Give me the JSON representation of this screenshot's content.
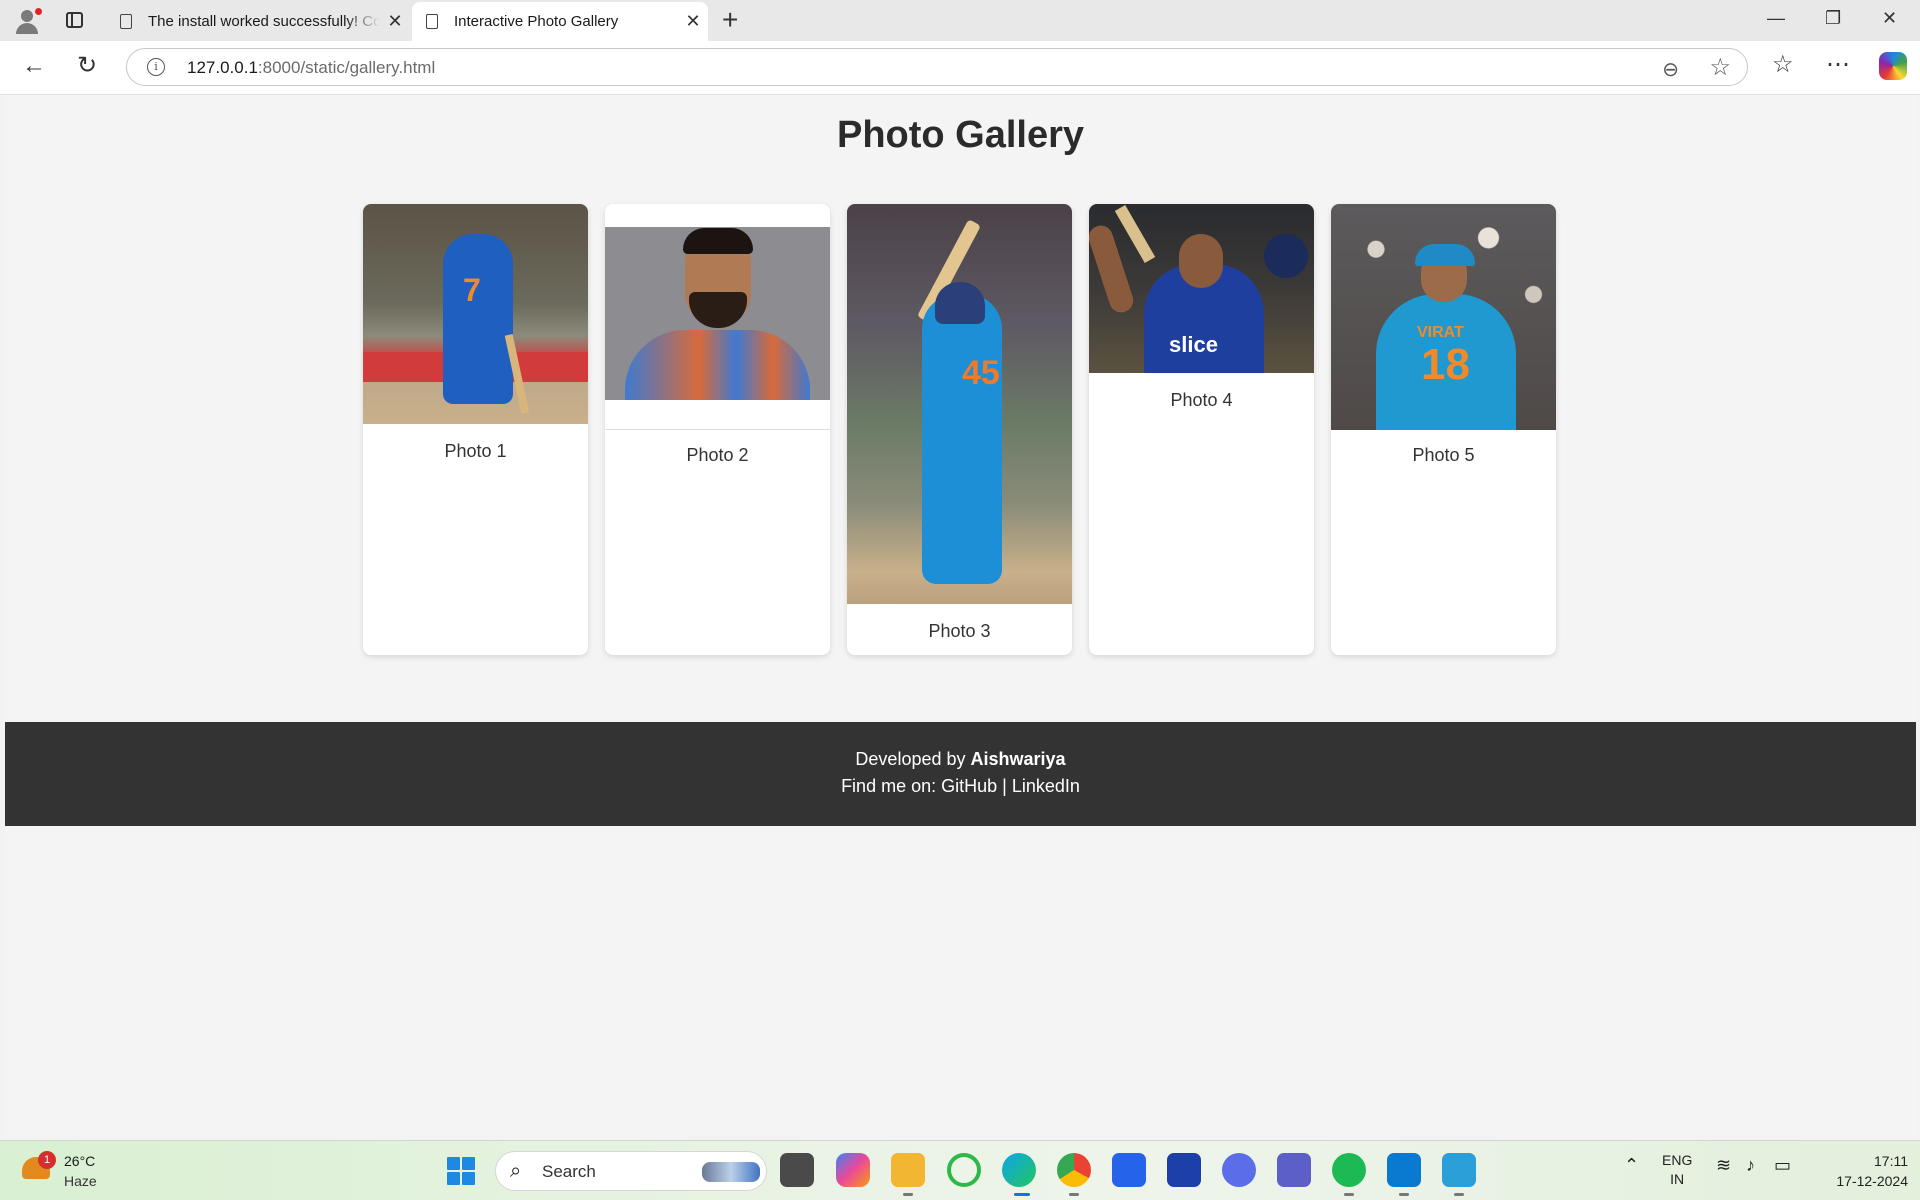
{
  "browser": {
    "tabs": [
      {
        "title": "The install worked successfully! Co"
      },
      {
        "title": "Interactive Photo Gallery"
      }
    ],
    "url_host": "127.0.0.1",
    "url_rest": ":8000/static/gallery.html"
  },
  "page": {
    "title": "Photo Gallery",
    "photos": [
      {
        "caption": "Photo 1",
        "jersey_text": "7"
      },
      {
        "caption": "Photo 2"
      },
      {
        "caption": "Photo 3",
        "jersey_text": "45"
      },
      {
        "caption": "Photo 4",
        "jersey_text": "slice"
      },
      {
        "caption": "Photo 5",
        "jersey_name": "VIRAT",
        "jersey_text": "18"
      }
    ],
    "footer": {
      "developed_by_prefix": "Developed by",
      "developer": "Aishwariya",
      "find_prefix": "Find me on:",
      "link_github": "GitHub",
      "separator": "|",
      "link_linkedin": "LinkedIn"
    }
  },
  "taskbar": {
    "weather_temp": "26°C",
    "weather_condition": "Haze",
    "weather_badge": "1",
    "search_label": "Search",
    "lang_top": "ENG",
    "lang_bottom": "IN",
    "time": "17:11",
    "date": "17-12-2024",
    "app_badge": "1"
  }
}
